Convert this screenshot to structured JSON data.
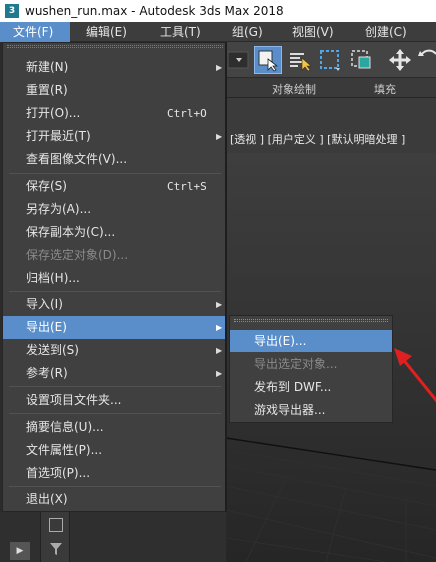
{
  "window": {
    "title": "wushen_run.max - Autodesk 3ds Max 2018"
  },
  "menubar": {
    "items": [
      {
        "label": "文件(F)"
      },
      {
        "label": "编辑(E)"
      },
      {
        "label": "工具(T)"
      },
      {
        "label": "组(G)"
      },
      {
        "label": "视图(V)"
      },
      {
        "label": "创建(C)"
      }
    ]
  },
  "ribbon": {
    "tabs": [
      "对象绘制",
      "填充"
    ]
  },
  "viewport": {
    "label": "[透视 ] [用户定义 ] [默认明暗处理 ]"
  },
  "file_menu": {
    "items": [
      {
        "label": "新建(N)",
        "arrow": "▶"
      },
      {
        "label": "重置(R)"
      },
      {
        "label": "打开(O)...",
        "shortcut": "Ctrl+O"
      },
      {
        "label": "打开最近(T)",
        "arrow": "▶"
      },
      {
        "label": "查看图像文件(V)..."
      },
      {
        "label": "保存(S)",
        "shortcut": "Ctrl+S"
      },
      {
        "label": "另存为(A)..."
      },
      {
        "label": "保存副本为(C)..."
      },
      {
        "label": "保存选定对象(D)..."
      },
      {
        "label": "归档(H)..."
      },
      {
        "label": "导入(I)",
        "arrow": "▶"
      },
      {
        "label": "导出(E)",
        "arrow": "▶"
      },
      {
        "label": "发送到(S)",
        "arrow": "▶"
      },
      {
        "label": "参考(R)",
        "arrow": "▶"
      },
      {
        "label": "设置项目文件夹..."
      },
      {
        "label": "摘要信息(U)..."
      },
      {
        "label": "文件属性(P)..."
      },
      {
        "label": "首选项(P)..."
      },
      {
        "label": "退出(X)"
      }
    ]
  },
  "export_submenu": {
    "items": [
      {
        "label": "导出(E)..."
      },
      {
        "label": "导出选定对象..."
      },
      {
        "label": "发布到 DWF..."
      },
      {
        "label": "游戏导出器..."
      }
    ]
  },
  "colors": {
    "highlight": "#5a8ecb",
    "annotation_arrow": "#e02020"
  }
}
